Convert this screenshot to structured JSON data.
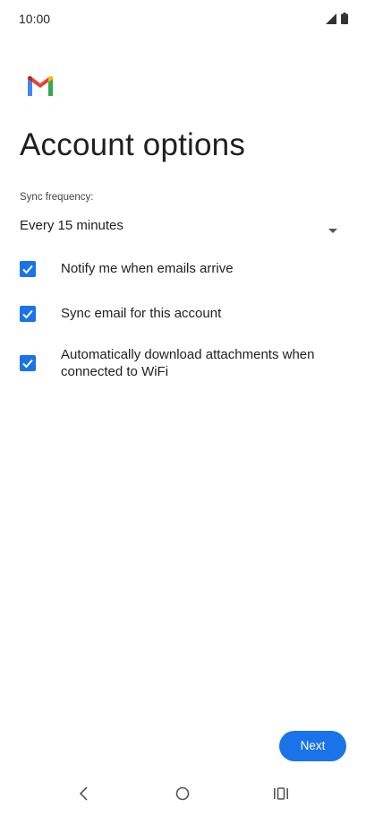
{
  "status_bar": {
    "time": "10:00",
    "icons": [
      "signal-icon",
      "battery-icon"
    ]
  },
  "app": {
    "logo": "gmail-logo"
  },
  "page": {
    "title": "Account options"
  },
  "sync": {
    "label": "Sync frequency:",
    "value": "Every 15 minutes"
  },
  "options": [
    {
      "label": "Notify me when emails arrive",
      "checked": true
    },
    {
      "label": "Sync email for this account",
      "checked": true
    },
    {
      "label": "Automatically download attachments when connected to WiFi",
      "checked": true
    }
  ],
  "actions": {
    "next_label": "Next"
  },
  "nav_bar": {
    "buttons": [
      "back-icon",
      "home-icon",
      "recents-icon"
    ]
  },
  "colors": {
    "accent": "#1a73e8",
    "text": "#1f1f1f"
  }
}
